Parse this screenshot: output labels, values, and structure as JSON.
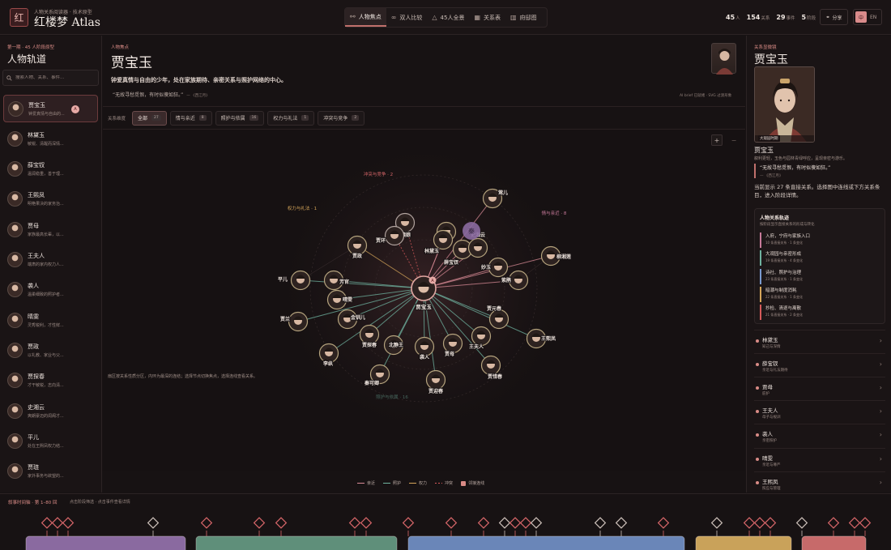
{
  "header": {
    "logo_char": "红",
    "subtitle": "人物关系阅读器 · 技术原型",
    "title": "红楼梦 Atlas",
    "nav": [
      {
        "label": "人物焦点",
        "icon": "share-nodes-icon",
        "active": true
      },
      {
        "label": "双人比较",
        "icon": "link-icon",
        "active": false
      },
      {
        "label": "45人全景",
        "icon": "triangle-icon",
        "active": false
      },
      {
        "label": "关系表",
        "icon": "table-icon",
        "active": false
      },
      {
        "label": "府邸图",
        "icon": "map-icon",
        "active": false
      }
    ],
    "stats": [
      {
        "value": "45",
        "unit": "人"
      },
      {
        "value": "154",
        "unit": "关系"
      },
      {
        "value": "29",
        "unit": "事件"
      },
      {
        "value": "5",
        "unit": "阶段"
      }
    ],
    "share_label": "分享",
    "lang_zh": "中",
    "lang_en": "EN"
  },
  "left": {
    "subtitle": "第一期 · 45 人阶段原型",
    "title": "人物轨道",
    "search_placeholder": "搜索人物、关系、事件…",
    "characters": [
      {
        "name": "贾宝玉",
        "desc": "钟爱真情与自由的...",
        "active": true,
        "badge": "A"
      },
      {
        "name": "林黛玉",
        "desc": "敏锐、清醒而深情..."
      },
      {
        "name": "薛宝钗",
        "desc": "温润稳重，善于理..."
      },
      {
        "name": "王熙凤",
        "desc": "明艳果决的家务治..."
      },
      {
        "name": "贾母",
        "desc": "家族最高长辈，以..."
      },
      {
        "name": "王夫人",
        "desc": "端肃的家内权力人..."
      },
      {
        "name": "袭人",
        "desc": "温柔细致的照护者..."
      },
      {
        "name": "晴雯",
        "desc": "灵秀锐利，才性鲜..."
      },
      {
        "name": "贾政",
        "desc": "以礼教、家业与父..."
      },
      {
        "name": "贾探春",
        "desc": "才干敏锐，志向清..."
      },
      {
        "name": "史湘云",
        "desc": "爽朗豪迈的闺阁才..."
      },
      {
        "name": "平儿",
        "desc": "处在王熙凤权力结..."
      },
      {
        "name": "贾琏",
        "desc": "家外事务与欲望的..."
      }
    ]
  },
  "center": {
    "kicker": "人物焦点",
    "title": "贾宝玉",
    "desc": "钟爱真情与自由的少年，处在家族期待、亲密关系与照护网络的中心。",
    "quote": "“无故寻愁觅恨，有时似傻如狂。”",
    "quote_src": "— 《西江月》",
    "tag": "AI brief 已就绪 · SVG 过渡形象",
    "filter_label": "关系维度",
    "filters": [
      {
        "label": "全部",
        "count": "27",
        "active": true
      },
      {
        "label": "情与亲近",
        "count": "8"
      },
      {
        "label": "照护与依属",
        "count": "16"
      },
      {
        "label": "权力与礼法",
        "count": "1"
      },
      {
        "label": "冲突与竞争",
        "count": "2"
      }
    ],
    "zoom_in": "+",
    "zoom_out": "−",
    "graph_note": "扇区按关系性质分区，内环为最深的连结；选择节点切换焦点，选择连线查看关系。",
    "legend": [
      {
        "label": "亲近",
        "color": "#d98b96"
      },
      {
        "label": "照护",
        "color": "#6fb3a0"
      },
      {
        "label": "权力",
        "color": "#d6a65a"
      },
      {
        "label": "冲突",
        "color": "#d65a5a"
      }
    ],
    "legend_toggle": "邻接连线"
  },
  "graph": {
    "focus": "贾宝玉",
    "focus_badge": "A",
    "qin_char": "秦",
    "sectors": [
      {
        "label": "冲突与竞争 · 2",
        "color": "#d9676a"
      },
      {
        "label": "权力与礼法 · 1",
        "color": "#d6a65a"
      },
      {
        "label": "情与亲近 · 8",
        "color": "#c77a9a"
      },
      {
        "label": "照护与依属 · 16",
        "color": "#6fb3a0"
      }
    ],
    "nodes": [
      {
        "name": "莺儿",
        "kind": "close"
      },
      {
        "name": "秦钟",
        "kind": "close"
      },
      {
        "name": "林黛玉",
        "kind": "close"
      },
      {
        "name": "薛宝钗",
        "kind": "close"
      },
      {
        "name": "史湘云",
        "kind": "close"
      },
      {
        "name": "柳湘莲",
        "kind": "close"
      },
      {
        "name": "妙玉",
        "kind": "close"
      },
      {
        "name": "紫鹃",
        "kind": "close"
      },
      {
        "name": "赵姨娘",
        "kind": "conflict"
      },
      {
        "name": "贾环",
        "kind": "conflict"
      },
      {
        "name": "贾政",
        "kind": "power"
      },
      {
        "name": "平儿",
        "kind": "care"
      },
      {
        "name": "芳官",
        "kind": "care"
      },
      {
        "name": "晴雯",
        "kind": "care"
      },
      {
        "name": "金钏儿",
        "kind": "care"
      },
      {
        "name": "贾兰",
        "kind": "care"
      },
      {
        "name": "贾探春",
        "kind": "care"
      },
      {
        "name": "北静王",
        "kind": "care"
      },
      {
        "name": "袭人",
        "kind": "care"
      },
      {
        "name": "贾母",
        "kind": "care"
      },
      {
        "name": "王夫人",
        "kind": "care"
      },
      {
        "name": "贾元春",
        "kind": "care"
      },
      {
        "name": "王熙凤",
        "kind": "care"
      },
      {
        "name": "李纨",
        "kind": "care"
      },
      {
        "name": "秦可卿",
        "kind": "care"
      },
      {
        "name": "贾惜春",
        "kind": "care"
      },
      {
        "name": "贾迎春",
        "kind": "care"
      }
    ]
  },
  "right": {
    "kicker": "关系显微镜",
    "title": "贾宝玉",
    "portrait_caption": "大观园时期",
    "name": "贾宝玉",
    "sub": "叙利更轻，玉色与园林青绿呼应，呈现亲密与游乐。",
    "quote": "“无故寻愁觅恨，有时似傻如狂。”",
    "quote_src": "— 《西江月》",
    "info": "当前显示 27 条直接关系。选择图中连线或下方关系条目，进入阶段详情。",
    "track_title": "人物关系轨迹",
    "track_desc": "按阶段显示直接关系的形成与转化",
    "stages": [
      {
        "name": "入府，宁府与家族入口",
        "meta": "10 条直接关系 · 1 条变化",
        "color": "#c77a9a"
      },
      {
        "name": "大观园与亲密形成",
        "meta": "19 条直接关系 · 4 条变化",
        "color": "#6fb3a0"
      },
      {
        "name": "诗社、照护与治理",
        "meta": "23 条直接关系 · 1 条变化",
        "color": "#7a9ad0"
      },
      {
        "name": "暗潮与制度消耗",
        "meta": "22 条直接关系 · 1 条变化",
        "color": "#d6a65a"
      },
      {
        "name": "抄检、清逐与离散",
        "meta": "21 条直接关系 · 2 条变化",
        "color": "#d65a5a"
      }
    ],
    "relations": [
      {
        "name": "林黛玉",
        "rel": "知己与深情"
      },
      {
        "name": "薛宝钗",
        "rel": "亲近与礼法期待"
      },
      {
        "name": "贾母",
        "rel": "庇护"
      },
      {
        "name": "王夫人",
        "rel": "母子与规训"
      },
      {
        "name": "袭人",
        "rel": "亲密照护"
      },
      {
        "name": "晴雯",
        "rel": "亲近与尊严"
      },
      {
        "name": "王熙凤",
        "rel": "照应与管理"
      }
    ]
  },
  "timeline": {
    "label": "叙事时间轴 · 第 1–80 回",
    "hint": "点击阶段筛选 · 点击事件查看详情",
    "stage_colors": [
      "#8a6aa0",
      "#5f8f7a",
      "#6a86b8",
      "#c9a25a",
      "#c76a6a"
    ]
  }
}
